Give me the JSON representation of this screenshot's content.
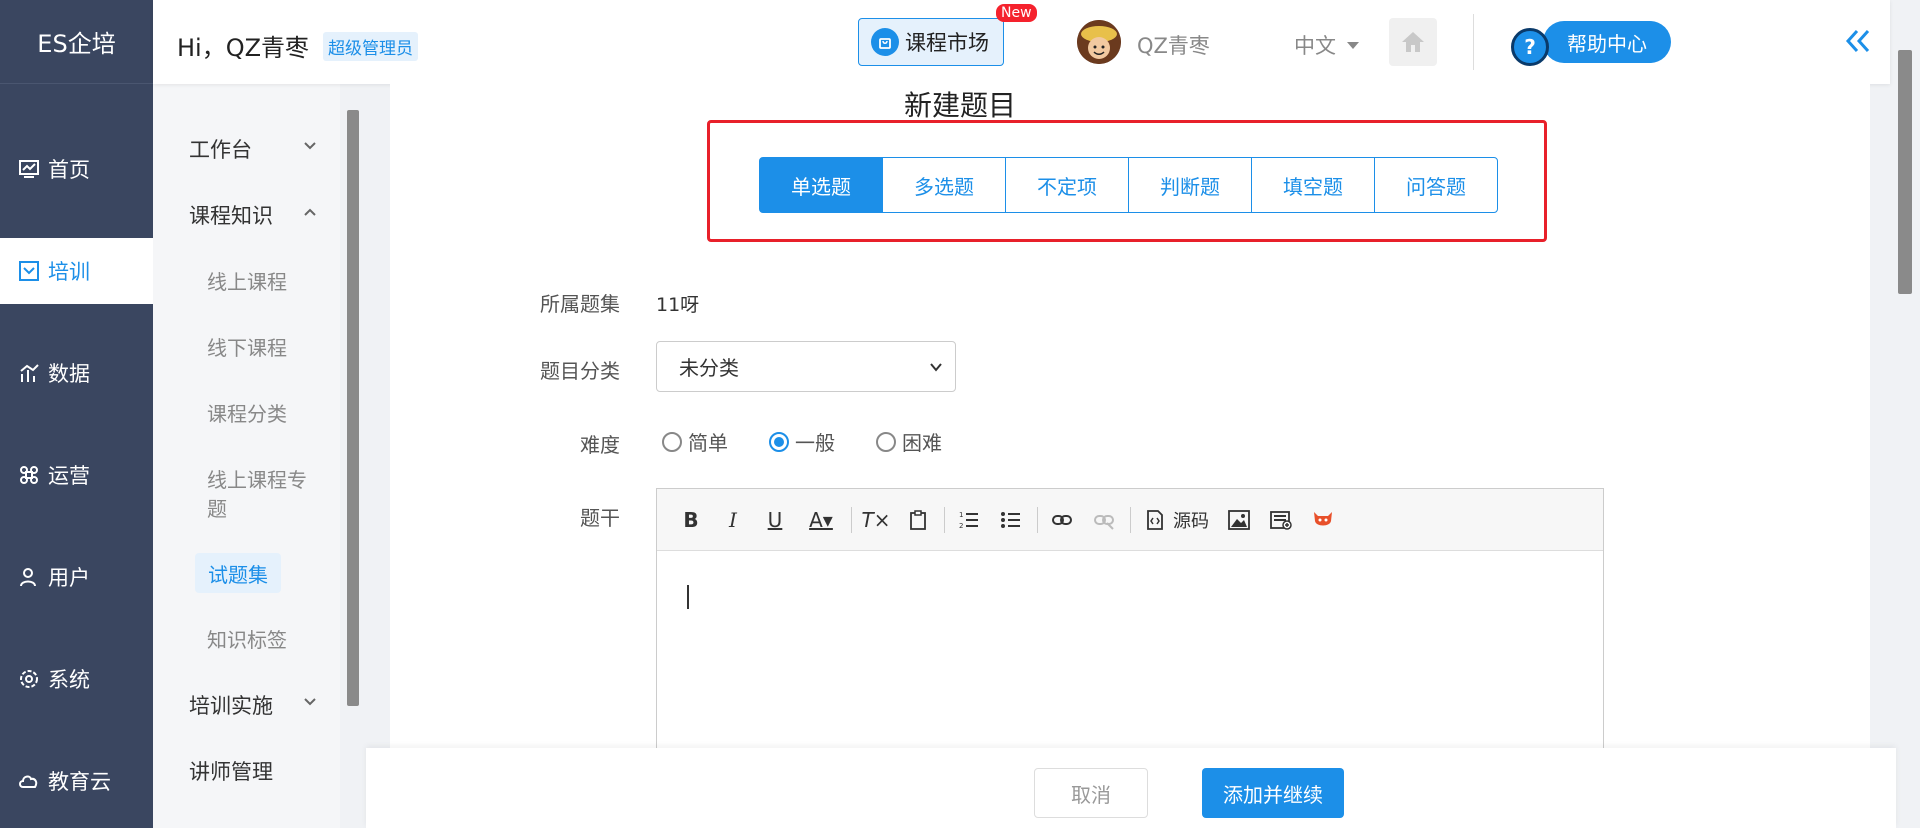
{
  "nav": {
    "logo": "ES企培",
    "items": [
      {
        "label": "首页",
        "icon": "dashboard-icon"
      },
      {
        "label": "培训",
        "icon": "training-icon"
      },
      {
        "label": "数据",
        "icon": "chart-icon"
      },
      {
        "label": "运营",
        "icon": "command-icon"
      },
      {
        "label": "用户",
        "icon": "user-icon"
      },
      {
        "label": "系统",
        "icon": "gear-icon"
      },
      {
        "label": "教育云",
        "icon": "cloud-icon"
      }
    ],
    "active_index": 1
  },
  "submenu": {
    "groups": [
      {
        "label": "工作台"
      },
      {
        "label": "课程知识"
      },
      {
        "label": "培训实施"
      },
      {
        "label": "讲师管理"
      }
    ],
    "items": [
      {
        "label": "线上课程"
      },
      {
        "label": "线下课程"
      },
      {
        "label": "课程分类"
      },
      {
        "label": "线上课程专"
      },
      {
        "label": "题"
      },
      {
        "label": "试题集"
      },
      {
        "label": "知识标签"
      }
    ]
  },
  "header": {
    "greeting": "Hi，QZ青枣",
    "role": "超级管理员",
    "market_label": "课程市场",
    "new_badge": "New",
    "username": "QZ青枣",
    "language": "中文",
    "help_label": "帮助中心",
    "help_q": "?"
  },
  "form": {
    "title": "新建题目",
    "types": [
      "单选题",
      "多选题",
      "不定项",
      "判断题",
      "填空题",
      "问答题"
    ],
    "active_type": 0,
    "set_label": "所属题集",
    "set_value": "11呀",
    "category_label": "题目分类",
    "category_value": "未分类",
    "difficulty_label": "难度",
    "difficulty_options": [
      "简单",
      "一般",
      "困难"
    ],
    "difficulty_selected": 1,
    "stem_label": "题干",
    "toolbar_source": "源码"
  },
  "footer": {
    "cancel_label": "取消",
    "add_label": "添加并继续"
  },
  "colors": {
    "accent": "#1c8fe8",
    "nav_bg": "#3a4660",
    "highlight": "#e8202a"
  }
}
